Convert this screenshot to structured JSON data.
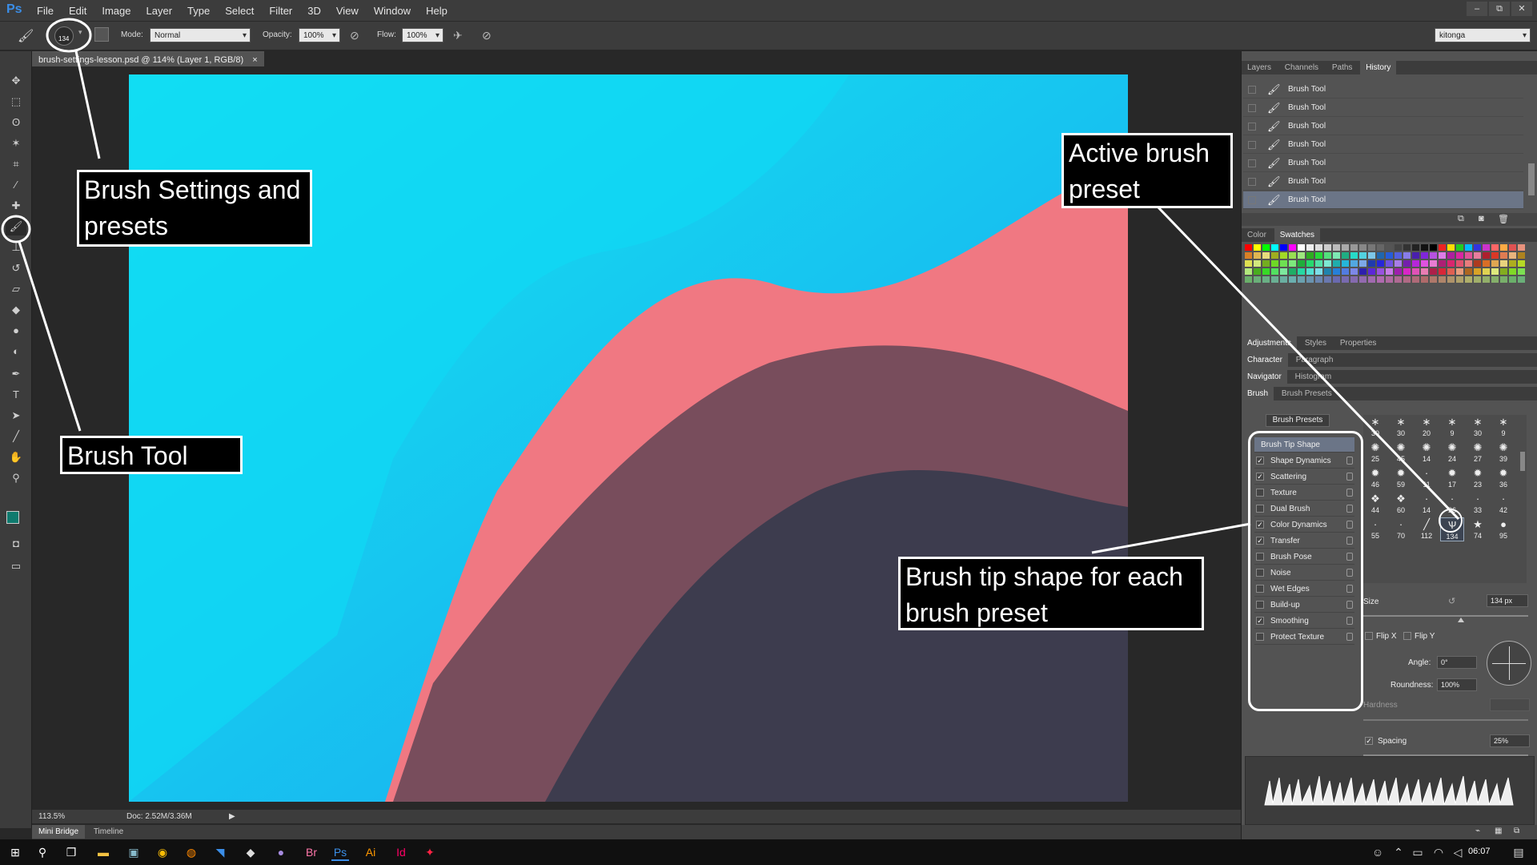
{
  "app": {
    "logo": "Ps",
    "brand_color": "#3b8ee8"
  },
  "menu": [
    "File",
    "Edit",
    "Image",
    "Layer",
    "Type",
    "Select",
    "Filter",
    "3D",
    "View",
    "Window",
    "Help"
  ],
  "window_controls": [
    "–",
    "⧉",
    "✕"
  ],
  "options": {
    "brush_size": "134",
    "mode_label": "Mode:",
    "mode_value": "Normal",
    "opacity_label": "Opacity:",
    "opacity_value": "100%",
    "flow_label": "Flow:",
    "flow_value": "100%",
    "workspace": "kitonga"
  },
  "document": {
    "tab_title": "brush-settings-lesson.psd @ 114% (Layer 1, RGB/8)",
    "close": "×"
  },
  "status": {
    "zoom": "113.5%",
    "doc": "Doc: 2.52M/3.36M"
  },
  "bottom_tabs": [
    "Mini Bridge",
    "Timeline"
  ],
  "panels": {
    "history_tabs": [
      "Layers",
      "Channels",
      "Paths",
      "History"
    ],
    "history_items": [
      "Brush Tool",
      "Brush Tool",
      "Brush Tool",
      "Brush Tool",
      "Brush Tool",
      "Brush Tool",
      "Brush Tool"
    ],
    "color_tabs": [
      "Color",
      "Swatches"
    ],
    "adj_tabs": [
      "Adjustments",
      "Styles",
      "Properties"
    ],
    "char_tabs": [
      "Character",
      "Paragraph"
    ],
    "nav_tabs": [
      "Navigator",
      "Histogram"
    ],
    "brush_tabs": [
      "Brush",
      "Brush Presets"
    ],
    "brush_presets_button": "Brush Presets",
    "brush_options": [
      {
        "label": "Brush Tip Shape",
        "checked": null
      },
      {
        "label": "Shape Dynamics",
        "checked": true
      },
      {
        "label": "Scattering",
        "checked": true
      },
      {
        "label": "Texture",
        "checked": false
      },
      {
        "label": "Dual Brush",
        "checked": false
      },
      {
        "label": "Color Dynamics",
        "checked": true
      },
      {
        "label": "Transfer",
        "checked": true
      },
      {
        "label": "Brush Pose",
        "checked": false
      },
      {
        "label": "Noise",
        "checked": false
      },
      {
        "label": "Wet Edges",
        "checked": false
      },
      {
        "label": "Build-up",
        "checked": false
      },
      {
        "label": "Smoothing",
        "checked": true
      },
      {
        "label": "Protect Texture",
        "checked": false
      }
    ],
    "preset_sizes": [
      "30",
      "30",
      "20",
      "9",
      "30",
      "9",
      "25",
      "45",
      "14",
      "24",
      "27",
      "39",
      "46",
      "59",
      "11",
      "17",
      "23",
      "36",
      "44",
      "60",
      "14",
      "26",
      "33",
      "42",
      "55",
      "70",
      "112",
      "134",
      "74",
      "95"
    ],
    "size_label": "Size",
    "size_value": "134 px",
    "flip_x": "Flip X",
    "flip_y": "Flip Y",
    "angle_label": "Angle:",
    "angle_value": "0°",
    "roundness_label": "Roundness:",
    "roundness_value": "100%",
    "hardness_label": "Hardness",
    "spacing_label": "Spacing",
    "spacing_value": "25%"
  },
  "annotations": {
    "brush_settings": "Brush Settings and presets",
    "brush_tool": "Brush Tool",
    "active_preset": "Active brush preset",
    "tip_shape": "Brush tip shape for each brush preset"
  },
  "taskbar": {
    "time": "06:07"
  }
}
